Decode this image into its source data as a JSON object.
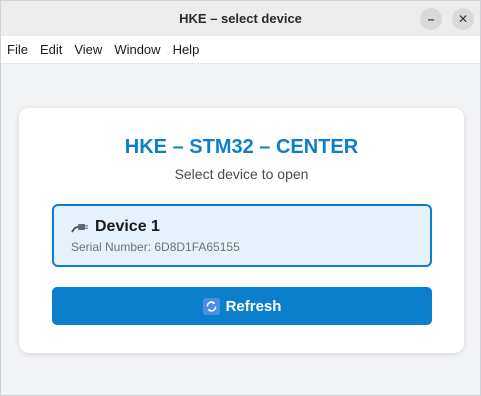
{
  "window": {
    "title": "HKE – select device",
    "minimize_glyph": "–",
    "close_glyph": "✕"
  },
  "menubar": {
    "items": [
      {
        "label": "File"
      },
      {
        "label": "Edit"
      },
      {
        "label": "View"
      },
      {
        "label": "Window"
      },
      {
        "label": "Help"
      }
    ]
  },
  "card": {
    "title": "HKE – STM32 – CENTER",
    "subtitle": "Select device to open",
    "devices": [
      {
        "name": "Device 1",
        "serial": "Serial Number: 6D8D1FA65155",
        "icon": "plug-icon"
      }
    ],
    "refresh_label": "Refresh",
    "refresh_icon": "refresh-icon"
  },
  "colors": {
    "accent": "#0b7fcc",
    "selected_bg": "#e5f2fb"
  }
}
